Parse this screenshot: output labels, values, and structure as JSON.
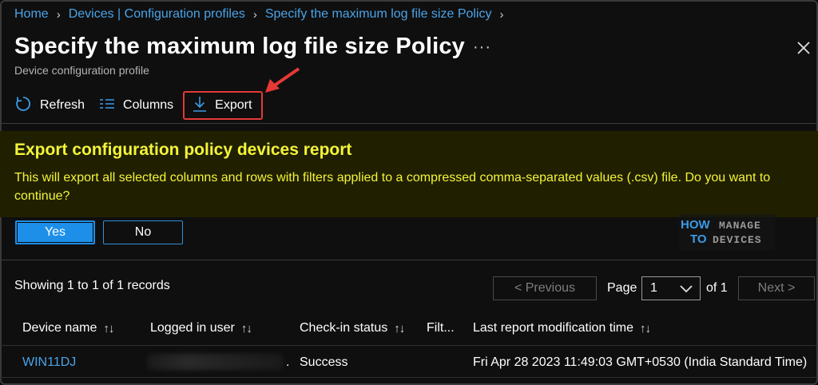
{
  "breadcrumb": {
    "items": [
      "Home",
      "Devices | Configuration profiles",
      "Specify the maximum log file size Policy"
    ]
  },
  "header": {
    "title": "Specify the maximum log file size Policy",
    "more": "···",
    "subtitle": "Device configuration profile"
  },
  "toolbar": {
    "refresh_label": "Refresh",
    "columns_label": "Columns",
    "export_label": "Export"
  },
  "banner": {
    "title": "Export configuration policy devices report",
    "text": "This will export all selected columns and rows with filters applied to a compressed comma-separated values (.csv) file. Do you want to continue?",
    "yes_label": "Yes",
    "no_label": "No"
  },
  "logo": {
    "line1a": "HOW",
    "line1b": "MANAGE",
    "line2a": "TO",
    "line2b": "DEVICES"
  },
  "pager": {
    "records_text": "Showing 1 to 1 of 1 records",
    "prev_label": "< Previous",
    "page_label": "Page",
    "page_value": "1",
    "of_label": "of 1",
    "next_label": "Next >"
  },
  "table": {
    "columns": [
      "Device name",
      "Logged in user",
      "Check-in status",
      "Filt...",
      "Last report modification time"
    ],
    "rows": [
      {
        "device_name": "WIN11DJ",
        "logged_in_user_suffix": ".",
        "checkin_status": "Success",
        "last_report": "Fri Apr 28 2023 11:49:03 GMT+0530 (India Standard Time)"
      }
    ]
  },
  "colors": {
    "accent": "#4aa3e8",
    "banner_bg": "#202000",
    "banner_text": "#f4f43a",
    "annotation_red": "#e53935"
  }
}
